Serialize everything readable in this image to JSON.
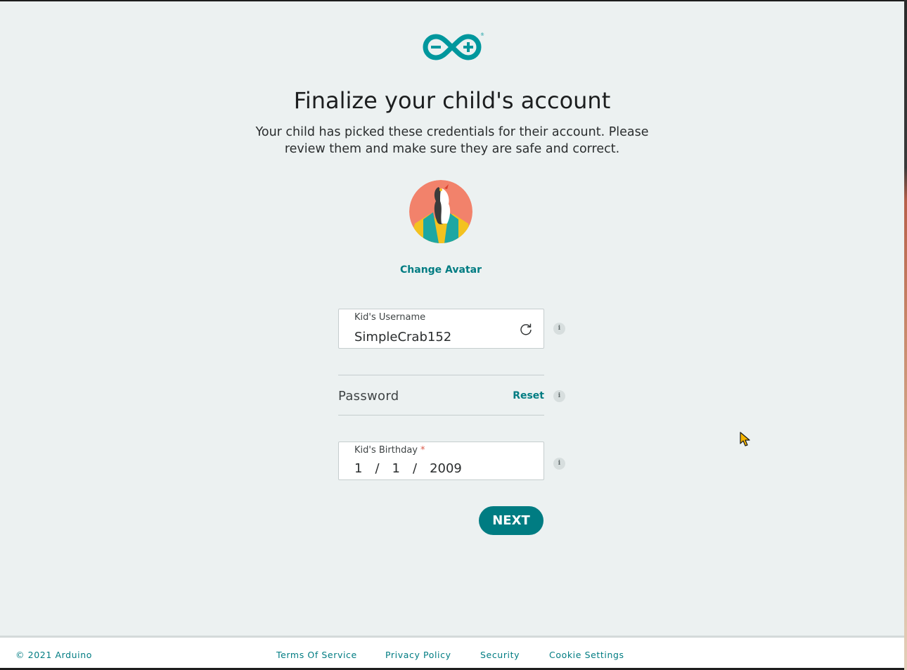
{
  "header": {
    "logo_name": "arduino-logo",
    "title": "Finalize your child's account",
    "subtitle_line1": "Your child has picked these credentials for their account. Please",
    "subtitle_line2": "review them and make sure they are safe and correct."
  },
  "avatar": {
    "change_label": "Change Avatar"
  },
  "form": {
    "username": {
      "label": "Kid's Username",
      "value": "SimpleCrab152",
      "icon": "refresh-icon"
    },
    "password": {
      "label": "Password",
      "reset_label": "Reset"
    },
    "birthday": {
      "label": "Kid's Birthday",
      "required_mark": "*",
      "day": "1",
      "month": "1",
      "year": "2009",
      "separator": "/"
    },
    "info_glyph": "i",
    "next_label": "NEXT"
  },
  "footer": {
    "copyright": "© 2021 Arduino",
    "links": [
      "Terms Of Service",
      "Privacy Policy",
      "Security",
      "Cookie Settings"
    ]
  },
  "colors": {
    "accent": "#007c82",
    "background": "#ecf1f1",
    "required": "#da5b4a"
  }
}
